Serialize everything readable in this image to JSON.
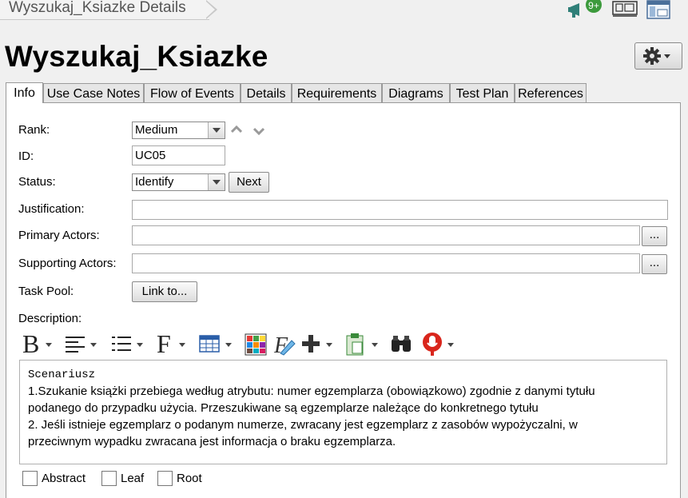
{
  "breadcrumb": {
    "text": "Wyszukaj_Ksiazke Details"
  },
  "notifications": {
    "badge": "9+"
  },
  "page": {
    "title": "Wyszukaj_Ksiazke"
  },
  "tabs": [
    {
      "label": "Info",
      "active": true
    },
    {
      "label": "Use Case Notes"
    },
    {
      "label": "Flow of Events"
    },
    {
      "label": "Details"
    },
    {
      "label": "Requirements"
    },
    {
      "label": "Diagrams"
    },
    {
      "label": "Test Plan"
    },
    {
      "label": "References"
    }
  ],
  "form": {
    "rank_label": "Rank:",
    "rank_value": "Medium",
    "id_label": "ID:",
    "id_value": "UC05",
    "status_label": "Status:",
    "status_value": "Identify",
    "next_button": "Next",
    "justification_label": "Justification:",
    "justification_value": "",
    "primary_actors_label": "Primary Actors:",
    "primary_actors_value": "",
    "supporting_actors_label": "Supporting Actors:",
    "supporting_actors_value": "",
    "ellipsis_button": "...",
    "task_pool_label": "Task Pool:",
    "link_button": "Link to...",
    "description_label": "Description:"
  },
  "description": {
    "heading": "Scenariusz",
    "lines": [
      "1.Szukanie książki przebiega według atrybutu:  numer egzemplarza (obowiązkowo) zgodnie z danymi tytułu",
      "podanego do przypadku użycia.  Przeszukiwane są egzemplarze należące do konkretnego tytułu",
      "2. Jeśli istnieje egzemplarz o podanym numerze,  zwracany jest egzemplarz z zasobów wypożyczalni,  w",
      "przeciwnym wypadku zwracana jest informacja o braku egzemplarza."
    ]
  },
  "checkboxes": {
    "abstract": "Abstract",
    "leaf": "Leaf",
    "root": "Root"
  },
  "colors": {
    "accent_red": "#d9261c",
    "badge_green": "#3c9a3c"
  }
}
